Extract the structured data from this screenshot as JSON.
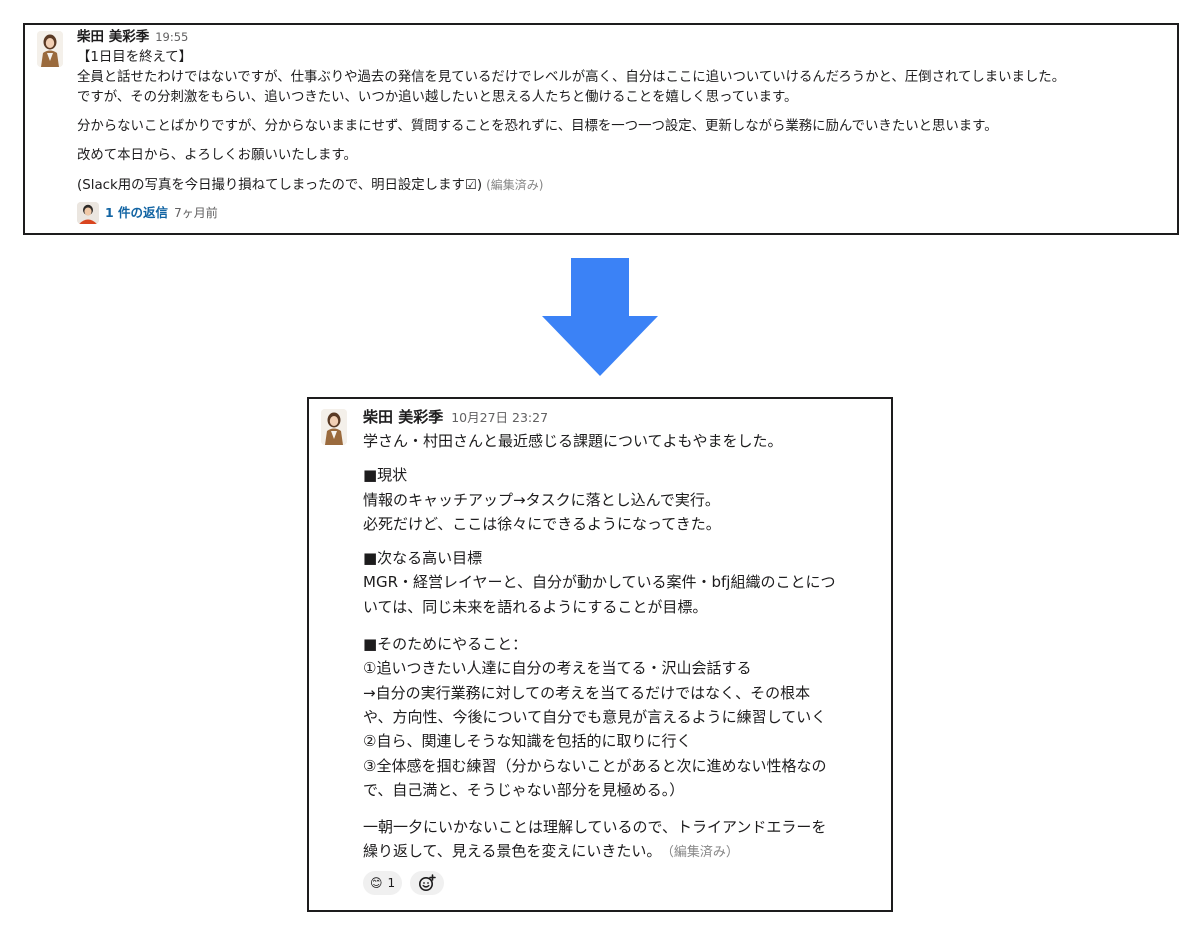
{
  "messages": [
    {
      "author": "柴田 美彩季",
      "time": "19:55",
      "lines": [
        "【1日目を終えて】",
        "全員と話せたわけではないですが、仕事ぶりや過去の発信を見ているだけでレベルが高く、自分はここに追いついていけるんだろうかと、圧倒されてしまいました。",
        "ですが、その分刺激をもらい、追いつきたい、いつか追い越したいと思える人たちと働けることを嬉しく思っています。"
      ],
      "para2": "分からないことばかりですが、分からないままにせず、質問することを恐れずに、目標を一つ一つ設定、更新しながら業務に励んでいきたいと思います。",
      "para3": "改めて本日から、よろしくお願いいたします。",
      "para4": "(Slack用の写真を今日撮り損ねてしまったので、明日設定します☑)",
      "edited": "(編集済み)",
      "thread": {
        "reply_label": "1 件の返信",
        "ago": "7ヶ月前"
      }
    },
    {
      "author": "柴田 美彩季",
      "time": "10月27日 23:27",
      "intro": "学さん・村田さんと最近感じる課題についてよもやまをした。",
      "section1": [
        "■現状",
        "情報のキャッチアップ→タスクに落とし込んで実行。",
        "必死だけど、ここは徐々にできるようになってきた。"
      ],
      "section2": [
        "■次なる高い目標",
        "MGR・経営レイヤーと、自分が動かしている案件・bfj組織のことにつ",
        "いては、同じ未来を語れるようにすることが目標。"
      ],
      "section3": [
        "■そのためにやること：",
        "①追いつきたい人達に自分の考えを当てる・沢山会話する",
        "→自分の実行業務に対しての考えを当てるだけではなく、その根本",
        "や、方向性、今後について自分でも意見が言えるように練習していく",
        "②自ら、関連しそうな知識を包括的に取りに行く",
        "③全体感を掴む練習（分からないことがあると次に進めない性格なの",
        "で、自己満と、そうじゃない部分を見極める。）"
      ],
      "closing": [
        "一朝一夕にいかないことは理解しているので、トライアンドエラーを",
        "繰り返して、見える景色を変えにいきたい。"
      ],
      "edited": "（編集済み）",
      "reactions": [
        {
          "emoji": "😊",
          "count": "1"
        }
      ]
    }
  ],
  "colors": {
    "link": "#1264a3",
    "arrow": "#3b82f6",
    "border": "#1d1c1d"
  },
  "icons": {
    "arrow": "arrow-down-icon",
    "add_reaction": "add-reaction-icon"
  }
}
